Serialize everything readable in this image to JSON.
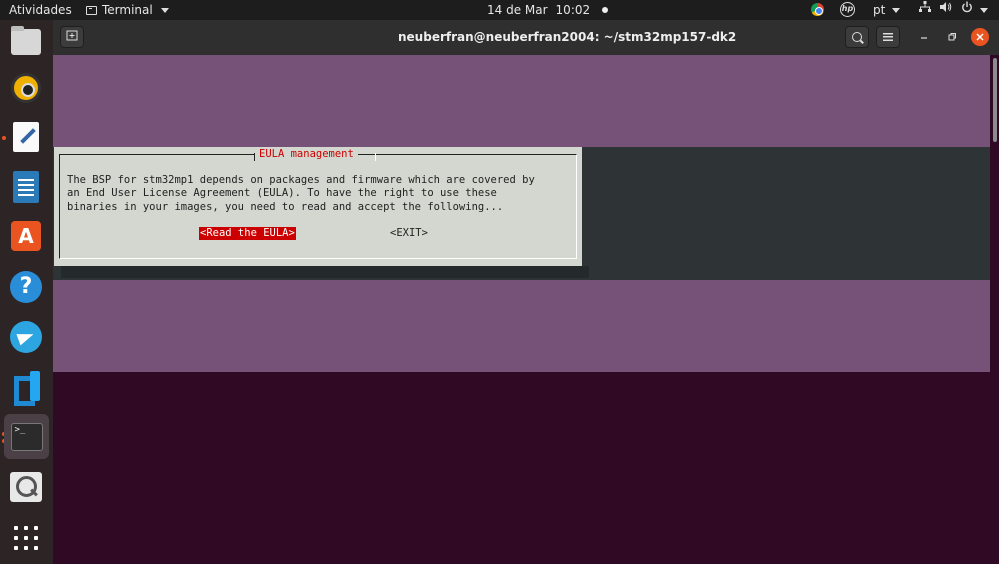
{
  "topbar": {
    "activities": "Atividades",
    "app_menu": "Terminal",
    "date": "14 de Mar",
    "time": "10:02",
    "language": "pt"
  },
  "dock": {
    "apps": [
      "files-icon",
      "rhythmbox-icon",
      "text-editor-icon",
      "writer-icon",
      "app-store-icon",
      "help-icon",
      "telegram-icon",
      "vscode-icon",
      "terminal-icon",
      "image-viewer-icon",
      "show-apps-icon"
    ],
    "help_glyph": "?",
    "store_glyph": "A",
    "terminal_glyph": ">_"
  },
  "window": {
    "title": "neuberfran@neuberfran2004: ~/stm32mp157-dk2"
  },
  "dialog": {
    "title": "EULA management",
    "body": "The BSP for stm32mp1 depends on packages and firmware which are covered by\nan End User License Agreement (EULA). To have the right to use these\nbinaries in your images, you need to read and accept the following...",
    "read_button": "<Read the EULA>",
    "exit_button": "<EXIT>"
  },
  "colors": {
    "terminal_bg": "#300a24",
    "whiptail_bg": "#765279",
    "dialog_bg": "#d3d7cf",
    "accent_red": "#cc0000",
    "ubuntu_orange": "#e95420"
  }
}
